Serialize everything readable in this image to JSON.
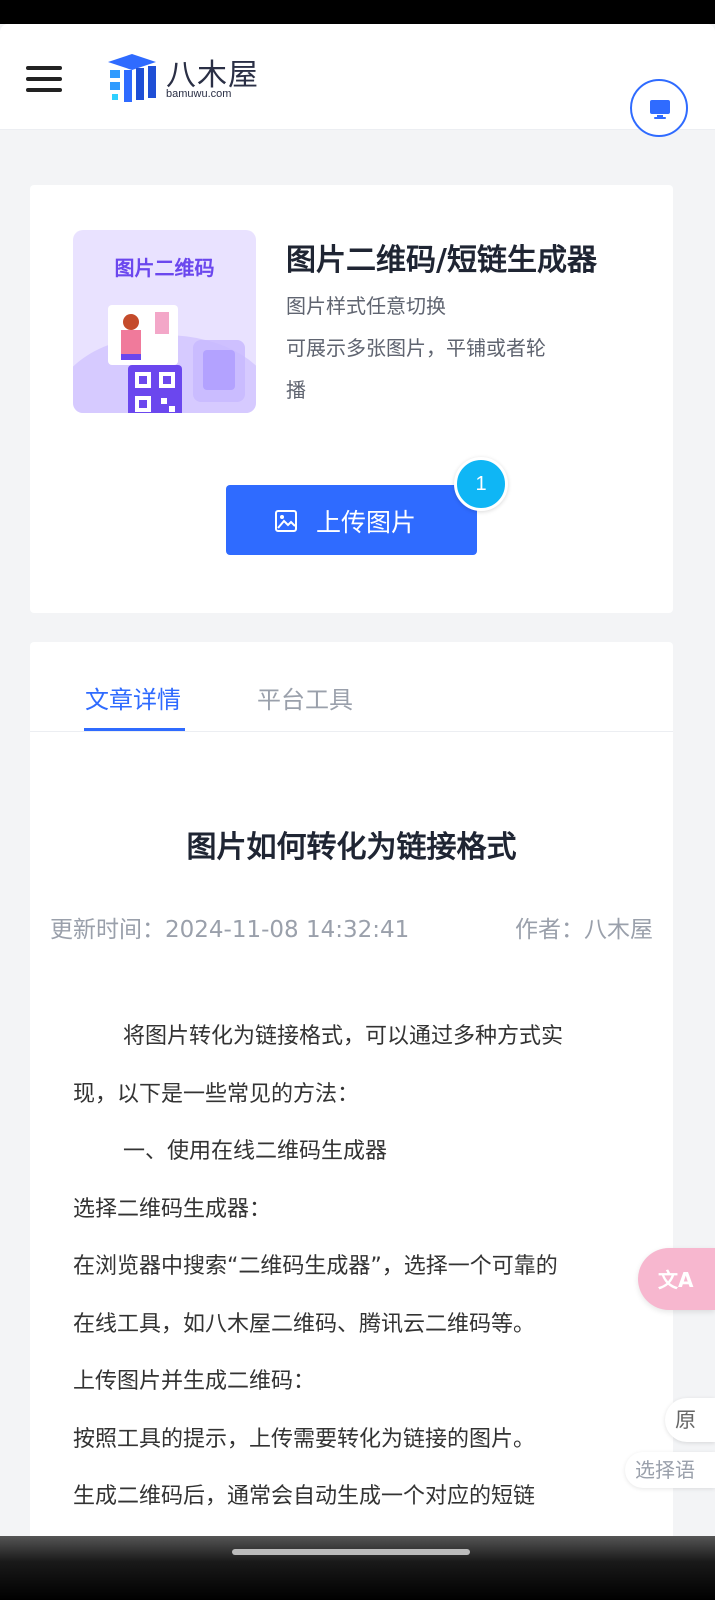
{
  "header": {
    "logo_name": "八木屋",
    "logo_domain": "bamuwu.com",
    "menu_icon": "hamburger-menu-icon",
    "monitor_icon": "monitor-icon"
  },
  "product": {
    "thumb_title": "图片二维码",
    "title": "图片二维码/短链生成器",
    "desc_lines": [
      "图片样式任意切换",
      "可展示多张图片，平铺或者轮",
      "播"
    ],
    "upload_label": "上传图片",
    "badge_count": "1"
  },
  "tabs": [
    {
      "label": "文章详情",
      "active": true
    },
    {
      "label": "平台工具",
      "active": false
    }
  ],
  "article": {
    "title": "图片如何转化为链接格式",
    "updated": "更新时间：2024-11-08 14:32:41",
    "author": "作者：八木屋",
    "paragraphs": [
      "将图片转化为链接格式，可以通过多种方式实",
      "现，以下是一些常见的方法：",
      "一、使用在线二维码生成器",
      "选择二维码生成器：",
      "在浏览器中搜索“二维码生成器”，选择一个可靠的",
      "在线工具，如八木屋二维码、腾讯云二维码等。",
      "上传图片并生成二维码：",
      "按照工具的提示，上传需要转化为链接的图片。",
      "生成二维码后，通常会自动生成一个对应的短链"
    ]
  },
  "floating": {
    "translate_icon": "translate-icon",
    "original_label": "原",
    "language_label": "选择语"
  },
  "colors": {
    "accent": "#2f6bff",
    "badge": "#0fb6f5",
    "thumb_bg": "#e9e2ff",
    "translate_bg": "#f7b7cf"
  }
}
